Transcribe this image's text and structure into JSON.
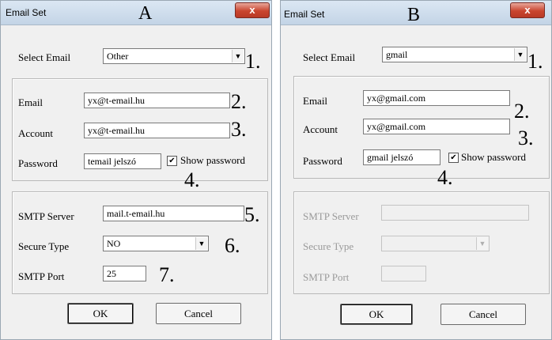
{
  "dialogs": {
    "A": {
      "title": "Email Set",
      "marker": "A",
      "close_symbol": "x",
      "select_email": {
        "label": "Select Email",
        "value": "Other",
        "num": "1."
      },
      "email": {
        "label": "Email",
        "value": "yx@t-email.hu",
        "num": "2."
      },
      "account": {
        "label": "Account",
        "value": "yx@t-email.hu",
        "num": "3."
      },
      "password": {
        "label": "Password",
        "value": "temail jelszó",
        "num": "4."
      },
      "show_password": {
        "label": "Show password",
        "checked_symbol": "✔"
      },
      "smtp_server": {
        "label": "SMTP Server",
        "value": "mail.t-email.hu",
        "num": "5."
      },
      "secure_type": {
        "label": "Secure Type",
        "value": "NO",
        "num": "6."
      },
      "smtp_port": {
        "label": "SMTP Port",
        "value": "25",
        "num": "7."
      },
      "ok_label": "OK",
      "cancel_label": "Cancel"
    },
    "B": {
      "title": "Email Set",
      "marker": "B",
      "close_symbol": "x",
      "select_email": {
        "label": "Select Email",
        "value": "gmail",
        "num": "1."
      },
      "email": {
        "label": "Email",
        "value": "yx@gmail.com",
        "num": "2."
      },
      "account": {
        "label": "Account",
        "value": "yx@gmail.com",
        "num": "3."
      },
      "password": {
        "label": "Password",
        "value": "gmail jelszó",
        "num": "4."
      },
      "show_password": {
        "label": "Show password",
        "checked_symbol": "✔"
      },
      "smtp_server": {
        "label": "SMTP Server",
        "value": ""
      },
      "secure_type": {
        "label": "Secure Type",
        "value": ""
      },
      "smtp_port": {
        "label": "SMTP Port",
        "value": ""
      },
      "ok_label": "OK",
      "cancel_label": "Cancel"
    }
  },
  "icons": {
    "dropdown_arrow": "▼"
  },
  "colors": {
    "close_button": "#c9452f",
    "disabled_text": "#9a9a9a",
    "dialog_bg": "#f0f0f0"
  }
}
